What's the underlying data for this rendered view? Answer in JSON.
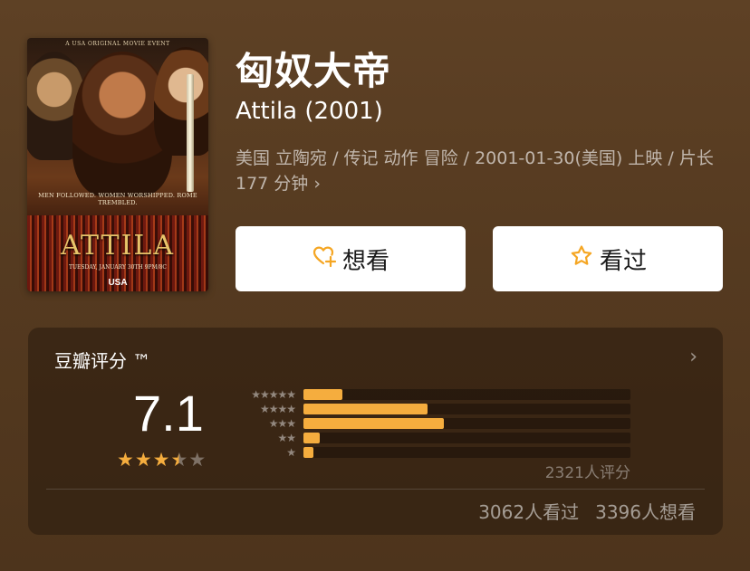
{
  "movie": {
    "title_cn": "匈奴大帝",
    "title_en": "Attila (2001)",
    "meta_line": "美国 立陶宛 / 传记 动作 冒险 / 2001-01-30(美国) 上映 / 片长177 分钟",
    "meta_chevron": "›"
  },
  "poster": {
    "top_tagline": "A USA ORIGINAL MOVIE EVENT",
    "tagline": "MEN FOLLOWED. WOMEN WORSHIPPED. ROME TREMBLED.",
    "title": "ATTILA",
    "airdate": "TUESDAY, JANUARY 30TH 9PM/8C",
    "network": "USA"
  },
  "actions": {
    "want_label": "想看",
    "want_icon": "heart-plus-icon",
    "seen_label": "看过",
    "seen_icon": "star-outline-icon",
    "accent": "#f5a623"
  },
  "rating": {
    "label": "豆瓣评分 ™",
    "chevron": "›",
    "score": "7.1",
    "stars": 3.5,
    "star_color": "#f5ad3e",
    "distribution": [
      {
        "stars": "★★★★★",
        "fraction": 0.12
      },
      {
        "stars": "★★★★",
        "fraction": 0.38
      },
      {
        "stars": "★★★",
        "fraction": 0.43
      },
      {
        "stars": "★★",
        "fraction": 0.05
      },
      {
        "stars": "★",
        "fraction": 0.03
      }
    ],
    "ratings_count": "2321人评分",
    "seen_count": "3062人看过",
    "want_count": "3396人想看"
  }
}
